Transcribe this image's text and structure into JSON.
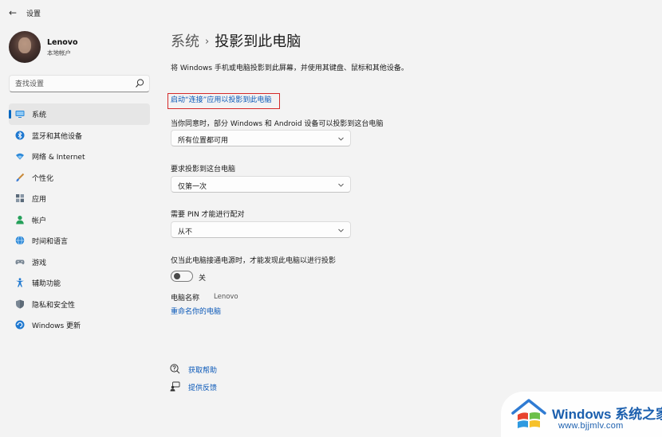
{
  "app": {
    "title": "设置",
    "back_glyph": "←"
  },
  "user": {
    "name": "Lenovo",
    "account_type": "本地帐户"
  },
  "search": {
    "placeholder": "查找设置"
  },
  "sidebar": {
    "items": [
      {
        "label": "系统",
        "icon": "monitor-icon",
        "active": true
      },
      {
        "label": "蓝牙和其他设备",
        "icon": "bluetooth-icon"
      },
      {
        "label": "网络 & Internet",
        "icon": "wifi-icon"
      },
      {
        "label": "个性化",
        "icon": "brush-icon"
      },
      {
        "label": "应用",
        "icon": "apps-icon"
      },
      {
        "label": "帐户",
        "icon": "person-icon"
      },
      {
        "label": "时间和语言",
        "icon": "globe-clock-icon"
      },
      {
        "label": "游戏",
        "icon": "gamepad-icon"
      },
      {
        "label": "辅助功能",
        "icon": "accessibility-icon"
      },
      {
        "label": "隐私和安全性",
        "icon": "shield-icon"
      },
      {
        "label": "Windows 更新",
        "icon": "update-icon"
      }
    ]
  },
  "breadcrumb": {
    "parent": "系统",
    "separator": "›",
    "current": "投影到此电脑"
  },
  "main": {
    "description": "将 Windows 手机或电脑投影到此屏幕，并使用其键盘、鼠标和其他设备。",
    "launch_link": "启动“连接”应用以投影到此电脑",
    "setting_1": {
      "label": "当你同意时，部分 Windows 和 Android 设备可以投影到这台电脑",
      "value": "所有位置都可用"
    },
    "setting_2": {
      "label": "要求投影到这台电脑",
      "value": "仅第一次"
    },
    "setting_3": {
      "label": "需要 PIN 才能进行配对",
      "value": "从不"
    },
    "power_setting": {
      "label": "仅当此电脑接通电源时，才能发现此电脑以进行投影",
      "toggle_state": "关",
      "on": false
    },
    "pc_name": {
      "label": "电脑名称",
      "value": "Lenovo"
    },
    "rename_link": "重命名你的电脑"
  },
  "help": {
    "get_help": "获取帮助",
    "feedback": "提供反馈"
  },
  "watermark": {
    "brand": "Windows",
    "brand_cn": "系统之家",
    "url": "www.bjjmlv.com"
  },
  "colors": {
    "accent": "#0067c0",
    "link": "#0a58b8",
    "highlight_border": "#d42a2a",
    "background": "#f3f3f3"
  }
}
